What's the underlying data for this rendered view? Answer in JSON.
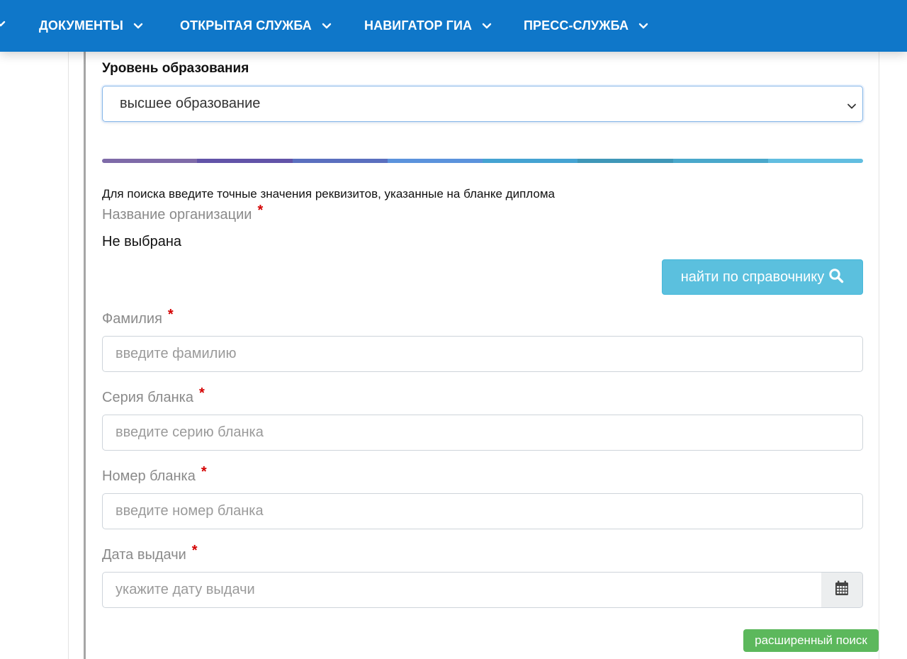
{
  "nav": {
    "items": [
      {
        "label": "ДОКУМЕНТЫ"
      },
      {
        "label": "ОТКРЫТАЯ СЛУЖБА"
      },
      {
        "label": "НАВИГАТОР ГИА"
      },
      {
        "label": "ПРЕСС-СЛУЖБА"
      }
    ],
    "background": "#0f77c9"
  },
  "form": {
    "education_level_label": "Уровень образования",
    "education_level_value": "высшее образование",
    "hint": "Для поиска введите точные значения реквизитов, указанные на бланке диплома",
    "organization": {
      "label": "Название организации",
      "value": "Не выбрана",
      "lookup_button": "найти по справочнику"
    },
    "surname": {
      "label": "Фамилия",
      "placeholder": "введите фамилию"
    },
    "series": {
      "label": "Серия бланка",
      "placeholder": "введите серию бланка"
    },
    "number": {
      "label": "Номер бланка",
      "placeholder": "введите номер бланка"
    },
    "issue_date": {
      "label": "Дата выдачи",
      "placeholder": "укажите дату выдачи"
    },
    "required_mark": "*",
    "advanced_search_button": "расширенный поиск"
  },
  "colors": {
    "accent": "#0f77c9",
    "info_button": "#5bc0de",
    "success_button": "#5cb85c",
    "required": "#d40000",
    "stripe": [
      "#7e6aa8",
      "#6253a8",
      "#5a6fbf",
      "#5b93dc",
      "#45a3d2",
      "#3f97b8",
      "#4aa8cb",
      "#62bee0"
    ]
  },
  "icons": {
    "nav_chevron": "chevron-down-icon",
    "search": "search-icon",
    "calendar": "calendar-icon"
  }
}
